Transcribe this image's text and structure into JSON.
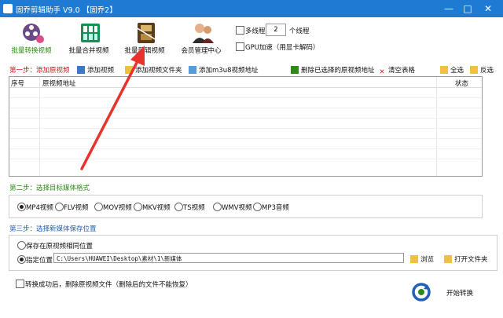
{
  "window": {
    "title": "固乔剪辑助手 V9.0 【固乔2】",
    "controls": [
      "—",
      "□",
      "✕"
    ]
  },
  "toolbar": {
    "tools": [
      {
        "label": "批量转换视频",
        "icon": "reel-convert-icon"
      },
      {
        "label": "批量合并视频",
        "icon": "merge-film-icon"
      },
      {
        "label": "批量剪辑视频",
        "icon": "film-cut-icon"
      },
      {
        "label": "会员管理中心",
        "icon": "members-icon"
      }
    ],
    "multithread_label": "多线程",
    "thread_count": "2",
    "thread_unit": "个线程",
    "gpu_label": "GPU加速（用显卡解码）"
  },
  "step1": {
    "title": "第一步：添加原视频",
    "add_video": "添加视频",
    "add_folder": "添加视频文件夹",
    "add_m3u8": "添加m3u8视频地址",
    "delete_selected": "删除已选择的原视频地址",
    "clear_table": "清空表格",
    "select_all": "全选",
    "invert": "反选"
  },
  "table": {
    "columns": [
      "序号",
      "原视频地址",
      "状态"
    ]
  },
  "step2": {
    "title": "第二步：选择目标媒体格式",
    "formats": [
      "MP4视频",
      "FLV视频",
      "MOV视频",
      "MKV视频",
      "TS视频",
      "WMV视频",
      "MP3音频"
    ],
    "selected": "MP4视频"
  },
  "step3": {
    "title": "第三步：选择新媒体保存位置",
    "same_location": "保存在原视频相同位置",
    "specify": "指定位置",
    "path": "C:\\Users\\HUAWEI\\Desktop\\素材\\1\\新媒体",
    "browse": "浏览",
    "open_folder": "打开文件夹"
  },
  "footer": {
    "delete_after": "转换成功后，删除原视频文件（删除后的文件不能恢复）",
    "start": "开始转换"
  },
  "colors": {
    "titlebar": "#1f7ad4",
    "step_red": "#c8171b",
    "step_green": "#2c8a18",
    "step_blue": "#1f5fb8",
    "arrow": "#e8322c"
  }
}
